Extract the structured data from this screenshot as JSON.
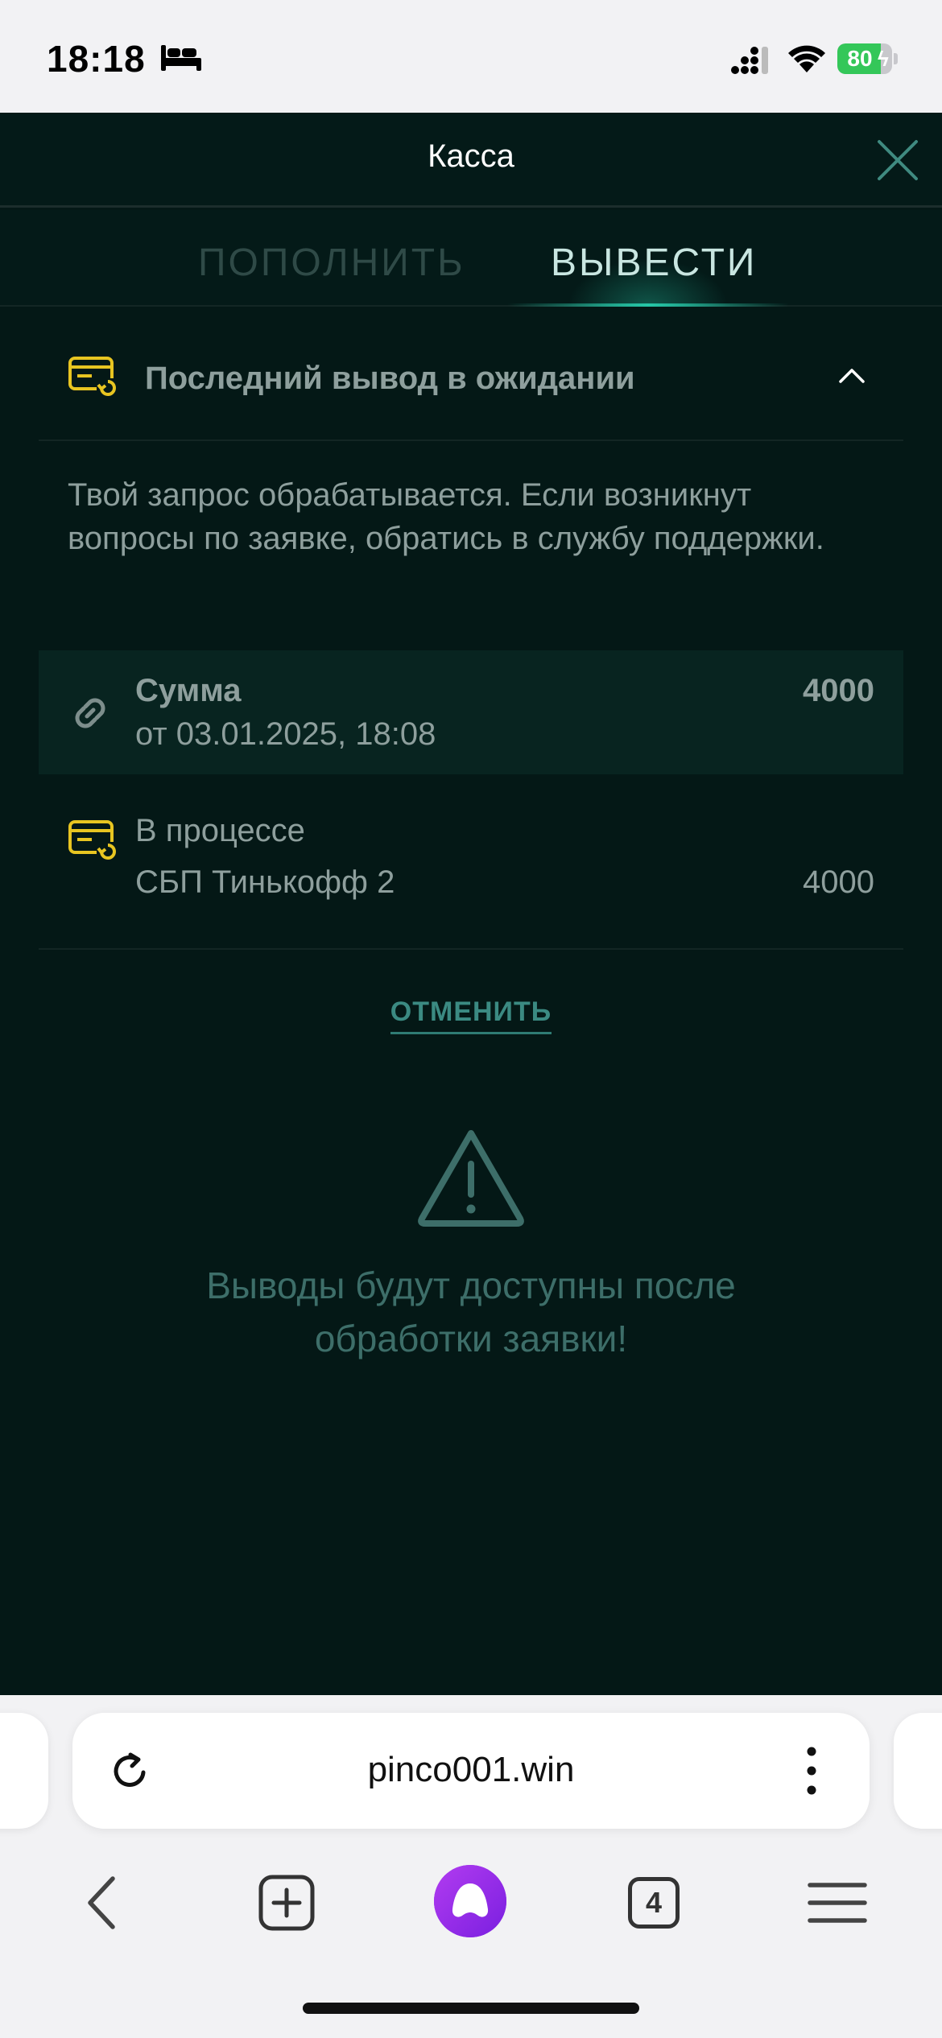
{
  "status_bar": {
    "time": "18:18",
    "battery": "80",
    "battery_level": 0.8,
    "battery_color": "#34c759"
  },
  "cashier": {
    "title": "Касса",
    "tabs": [
      {
        "label": "ПОПОЛНИТЬ",
        "active": false
      },
      {
        "label": "ВЫВЕСТИ",
        "active": true
      }
    ],
    "pending": {
      "title": "Последний вывод в ожидании",
      "notice": "Твой запрос обрабатывается. Если возникнут вопросы по заявке, обратись в службу поддержки.",
      "amount_label": "Сумма",
      "amount_date": "от 03.01.2025, 18:08",
      "amount_value": "4000",
      "status_label": "В процессе",
      "method": "СБП Тинькофф 2",
      "method_amount": "4000",
      "cancel_label": "ОТМЕНИТЬ"
    },
    "warning": {
      "line1": "Выводы будут доступны после",
      "line2": "обработки заявки!"
    },
    "colors": {
      "background": "#041816",
      "accent": "#26c7a7",
      "icon_yellow": "#e8c521"
    }
  },
  "browser": {
    "url": "pinco001.win",
    "tabs_count": "4"
  }
}
